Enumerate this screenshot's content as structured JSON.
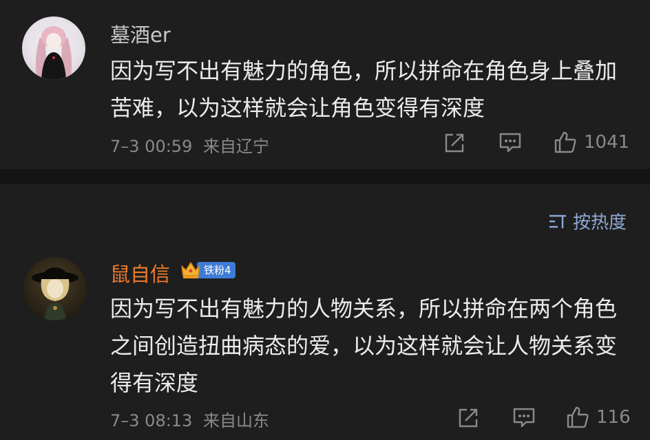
{
  "comments": [
    {
      "username": "墓酒er",
      "text": "因为写不出有魅力的角色，所以拼命在角色身上叠加苦难，以为这样就会让角色变得有深度",
      "time": "7–3 00:59",
      "location": "来自辽宁",
      "likes": "1041"
    },
    {
      "username": "鼠自信",
      "badge": "铁粉4",
      "text": "因为写不出有魅力的人物关系，所以拼命在两个角色之间创造扭曲病态的爱，以为这样就会让人物关系变得有深度",
      "time": "7–3 08:13",
      "location": "来自山东",
      "likes": "116"
    }
  ],
  "sort": {
    "label": "按热度",
    "icon": "sort-icon"
  },
  "colors": {
    "background": "#1e1e1e",
    "divider": "#141414",
    "text": "#ececec",
    "meta": "#8a8a8a",
    "vip_name": "#f07c2c",
    "sort": "#8fa8d6",
    "badge": "#3d7cd6"
  },
  "icons": [
    "share-icon",
    "comment-icon",
    "like-icon",
    "crown-icon",
    "sort-icon"
  ]
}
